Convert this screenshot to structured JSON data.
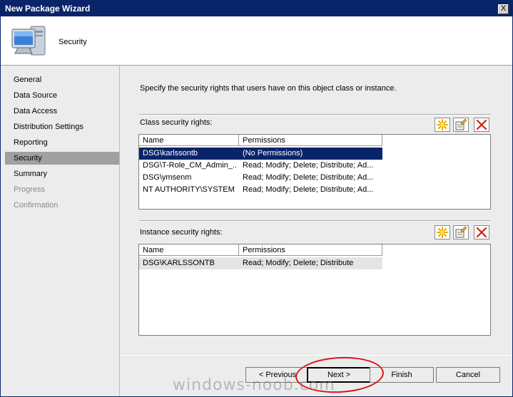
{
  "window": {
    "title": "New Package Wizard",
    "close_label": "X"
  },
  "header": {
    "title": "Security",
    "icon": "computer-icon"
  },
  "sidebar": {
    "items": [
      {
        "label": "General",
        "state": "normal"
      },
      {
        "label": "Data Source",
        "state": "normal"
      },
      {
        "label": "Data Access",
        "state": "normal"
      },
      {
        "label": "Distribution Settings",
        "state": "normal"
      },
      {
        "label": "Reporting",
        "state": "normal"
      },
      {
        "label": "Security",
        "state": "active"
      },
      {
        "label": "Summary",
        "state": "normal"
      },
      {
        "label": "Progress",
        "state": "disabled"
      },
      {
        "label": "Confirmation",
        "state": "disabled"
      }
    ]
  },
  "content": {
    "intro": "Specify the security rights that users have on this object class or instance.",
    "class_section": {
      "label": "Class security rights:",
      "columns": [
        "Name",
        "Permissions"
      ],
      "rows": [
        {
          "name": "DSG\\karlssontb",
          "permissions": "(No Permissions)"
        },
        {
          "name": "DSG\\T-Role_CM_Admin_...",
          "permissions": "Read; Modify; Delete; Distribute; Ad..."
        },
        {
          "name": "DSG\\ymsenm",
          "permissions": "Read; Modify; Delete; Distribute; Ad..."
        },
        {
          "name": "NT AUTHORITY\\SYSTEM",
          "permissions": "Read; Modify; Delete; Distribute; Ad..."
        }
      ]
    },
    "instance_section": {
      "label": "Instance security rights:",
      "columns": [
        "Name",
        "Permissions"
      ],
      "rows": [
        {
          "name": "DSG\\KARLSSONTB",
          "permissions": "Read; Modify; Delete; Distribute"
        }
      ]
    },
    "toolbar_icons": [
      "new-star-icon",
      "properties-icon",
      "delete-x-icon"
    ]
  },
  "footer": {
    "previous_label": "< Previous",
    "next_label": "Next >",
    "finish_label": "Finish",
    "cancel_label": "Cancel"
  },
  "watermark": "windows-noob.com",
  "colors": {
    "title_bar": "#0a246a",
    "selection": "#0a246a",
    "highlight_circle": "#d81818"
  }
}
